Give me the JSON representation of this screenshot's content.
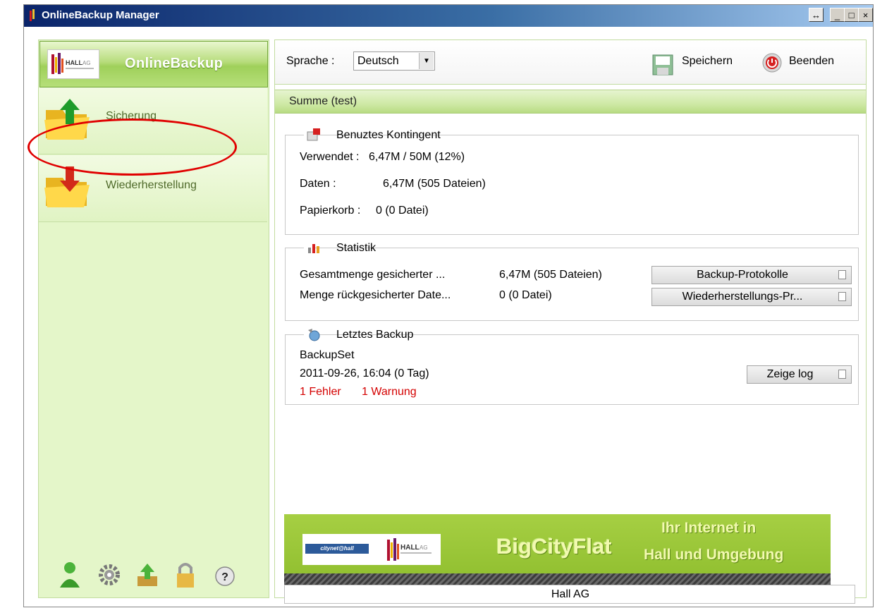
{
  "window": {
    "title": "OnlineBackup Manager",
    "controls": {
      "restore": "↔",
      "minimize": "_",
      "maximize": "□",
      "close": "×"
    }
  },
  "sidebar": {
    "brand": "OnlineBackup",
    "items": [
      {
        "label": "Sicherung",
        "icon": "folder-upload-icon"
      },
      {
        "label": "Wiederherstellung",
        "icon": "folder-download-icon"
      }
    ],
    "tools": [
      "user-icon",
      "settings-gear-icon",
      "upload-icon",
      "lock-icon",
      "help-icon"
    ]
  },
  "toolbar": {
    "language_label": "Sprache :",
    "language_value": "Deutsch",
    "save_label": "Speichern",
    "quit_label": "Beenden"
  },
  "summary": {
    "title": "Summe (test)",
    "quota": {
      "legend": "Benuztes Kontingent",
      "used_label": "Verwendet :",
      "used_value": "6,47M / 50M (12%)",
      "data_label": "Daten :",
      "data_value": "6,47M  (505 Dateien)",
      "trash_label": "Papierkorb :",
      "trash_value": "0  (0 Datei)"
    },
    "stats": {
      "legend": "Statistik",
      "backed_label": "Gesamtmenge gesicherter ...",
      "backed_value": "6,47M  (505 Dateien)",
      "restored_label": "Menge rückgesicherter Date...",
      "restored_value": "0  (0 Datei)",
      "backup_log_button": "Backup-Protokolle",
      "restore_log_button": "Wiederherstellungs-Pr..."
    },
    "last_backup": {
      "legend": "Letztes Backup",
      "set_name": "BackupSet",
      "datetime": "2011-09-26, 16:04 (0 Tag)",
      "errors": "1 Fehler",
      "warnings": "1 Warnung",
      "show_log_button": "Zeige log"
    }
  },
  "banner": {
    "city_logo": "citynet@hall",
    "headline": "BigCityFlat",
    "line1": "Ihr Internet in",
    "line2": "Hall und Umgebung"
  },
  "footer": {
    "company": "Hall AG"
  },
  "colors": {
    "accent_green": "#9fd05a",
    "error_red": "#d40000",
    "title_blue": "#0a246a"
  }
}
